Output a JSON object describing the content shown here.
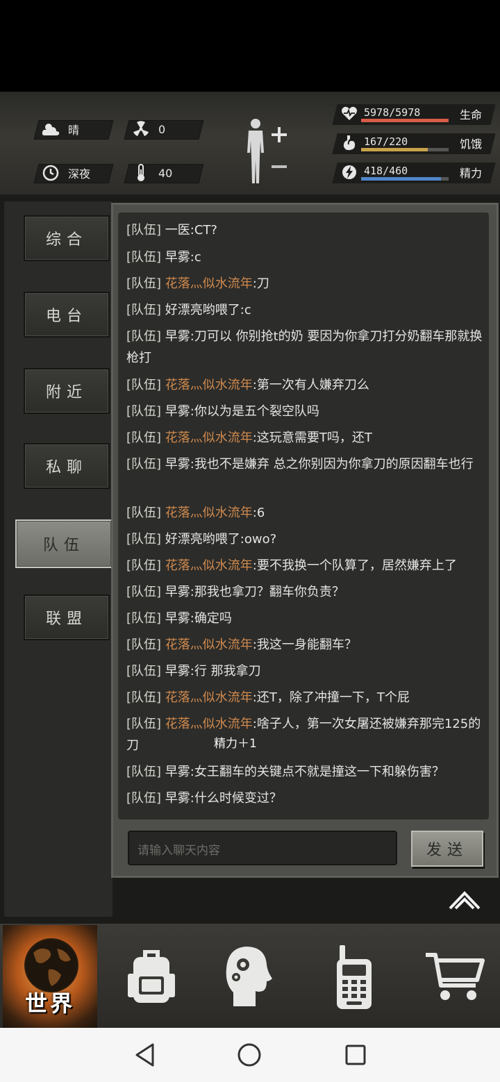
{
  "status": {
    "weather": "晴",
    "radiation": "0",
    "time_of_day": "深夜",
    "temperature": "40",
    "bars": [
      {
        "value": "5978/5978",
        "label": "生命",
        "fraction": 1.0,
        "color": "#d85c47",
        "icon": "heart-icon"
      },
      {
        "value": "167/220",
        "label": "饥饿",
        "fraction": 0.76,
        "color": "#c9a24a",
        "icon": "stomach-icon"
      },
      {
        "value": "418/460",
        "label": "精力",
        "fraction": 0.91,
        "color": "#4f86c8",
        "icon": "energy-icon"
      }
    ]
  },
  "tabs": [
    {
      "label": "综合",
      "active": false
    },
    {
      "label": "电台",
      "active": false
    },
    {
      "label": "附近",
      "active": false
    },
    {
      "label": "私聊",
      "active": false
    },
    {
      "label": "队伍",
      "active": true
    },
    {
      "label": "联盟",
      "active": false
    }
  ],
  "messages": [
    {
      "channel": "[队伍]",
      "name": "一医",
      "name_color": "white",
      "text": ":CT?"
    },
    {
      "channel": "[队伍]",
      "name": "早雾",
      "name_color": "white",
      "text": ":c"
    },
    {
      "channel": "[队伍]",
      "name": "花落灬似水流年",
      "name_color": "orange",
      "text": ":刀"
    },
    {
      "channel": "[队伍]",
      "name": "好漂亮哟喂了",
      "name_color": "white",
      "text": ":c"
    },
    {
      "channel": "[队伍]",
      "name": "早雾",
      "name_color": "white",
      "text": ":刀可以 你别抢t的奶 要因为你拿刀打分奶翻车那就换枪打"
    },
    {
      "channel": "[队伍]",
      "name": "花落灬似水流年",
      "name_color": "orange",
      "text": ":第一次有人嫌弃刀么"
    },
    {
      "channel": "[队伍]",
      "name": "早雾",
      "name_color": "white",
      "text": ":你以为是五个裂空队吗"
    },
    {
      "channel": "[队伍]",
      "name": "花落灬似水流年",
      "name_color": "orange",
      "text": ":这玩意需要T吗，还T"
    },
    {
      "channel": "[队伍]",
      "name": "早雾",
      "name_color": "white",
      "text": ":我也不是嫌弃 总之你别因为你拿刀的原因翻车也行"
    },
    {
      "channel": "[队伍]",
      "name": "花落灬似水流年",
      "name_color": "orange",
      "text": ":6"
    },
    {
      "channel": "[队伍]",
      "name": "好漂亮哟喂了",
      "name_color": "white",
      "text": ":owo?"
    },
    {
      "channel": "[队伍]",
      "name": "花落灬似水流年",
      "name_color": "orange",
      "text": ":要不我换一个队算了，居然嫌弃上了"
    },
    {
      "channel": "[队伍]",
      "name": "早雾",
      "name_color": "white",
      "text": ":那我也拿刀？翻车你负责？"
    },
    {
      "channel": "[队伍]",
      "name": "早雾",
      "name_color": "white",
      "text": ":确定吗"
    },
    {
      "channel": "[队伍]",
      "name": "花落灬似水流年",
      "name_color": "orange",
      "text": ":我这一身能翻车？"
    },
    {
      "channel": "[队伍]",
      "name": "早雾",
      "name_color": "white",
      "text": ":行 那我拿刀"
    },
    {
      "channel": "[队伍]",
      "name": "花落灬似水流年",
      "name_color": "orange",
      "text": ":还T，除了冲撞一下，T个屁"
    },
    {
      "channel": "[队伍]",
      "name": "花落灬似水流年",
      "name_color": "orange",
      "text": ":啥子人，第一次女屠还被嫌弃那完125的刀"
    },
    {
      "channel": "[队伍]",
      "name": "早雾",
      "name_color": "white",
      "text": ":女王翻车的关键点不就是撞这一下和躲伤害？"
    },
    {
      "channel": "[队伍]",
      "name": "早雾",
      "name_color": "white",
      "text": ":什么时候变过？"
    }
  ],
  "floating_text": "精力＋1",
  "input": {
    "placeholder": "请输入聊天内容",
    "value": ""
  },
  "send_label": "发送",
  "bottom_nav": {
    "world_label": "世界",
    "items": [
      "globe-icon",
      "backpack-icon",
      "head-gears-icon",
      "walkie-talkie-icon",
      "cart-icon"
    ]
  }
}
